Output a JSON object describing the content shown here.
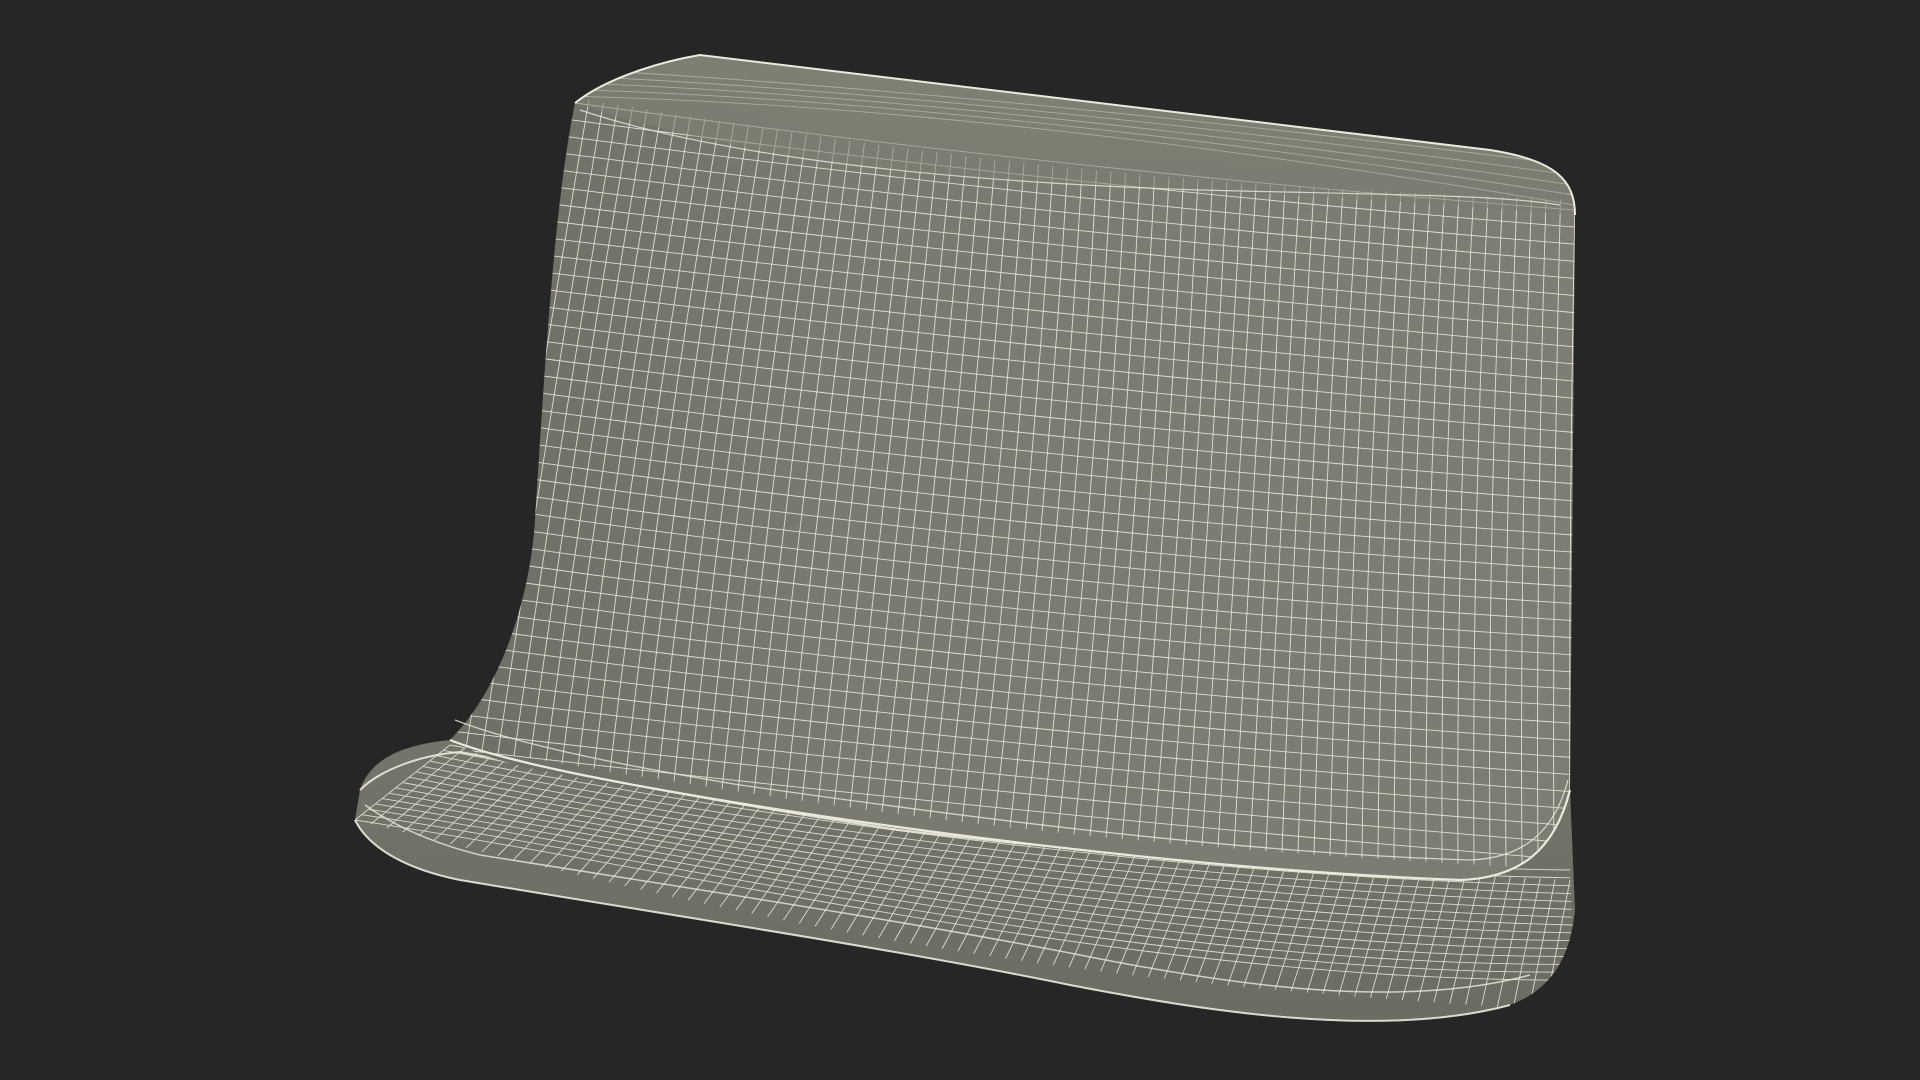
{
  "viewport": {
    "background_color": "#262626"
  },
  "model": {
    "object": "concrete-jersey-barrier-style-block",
    "render_mode": "wireframe-on-shaded",
    "surface_color": "#7a7a70",
    "surface_dark_color": "#66665e",
    "wire_color": "#e8e6d8"
  }
}
